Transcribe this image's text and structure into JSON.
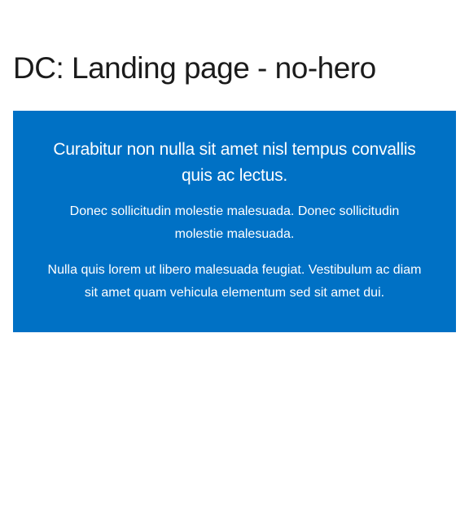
{
  "page": {
    "title": "DC: Landing page - no-hero"
  },
  "callout": {
    "heading": "Curabitur non nulla sit amet nisl tempus convallis quis ac lectus.",
    "paragraphs": [
      "Donec sollicitudin molestie malesuada. Donec sollicitudin molestie malesuada.",
      "Nulla quis lorem ut libero malesuada feugiat. Vestibulum ac diam sit amet quam vehicula elementum sed sit amet dui."
    ]
  },
  "colors": {
    "callout_background": "#0071c5",
    "callout_text": "#ffffff",
    "title_text": "#1b1b1b",
    "page_background": "#ffffff"
  }
}
